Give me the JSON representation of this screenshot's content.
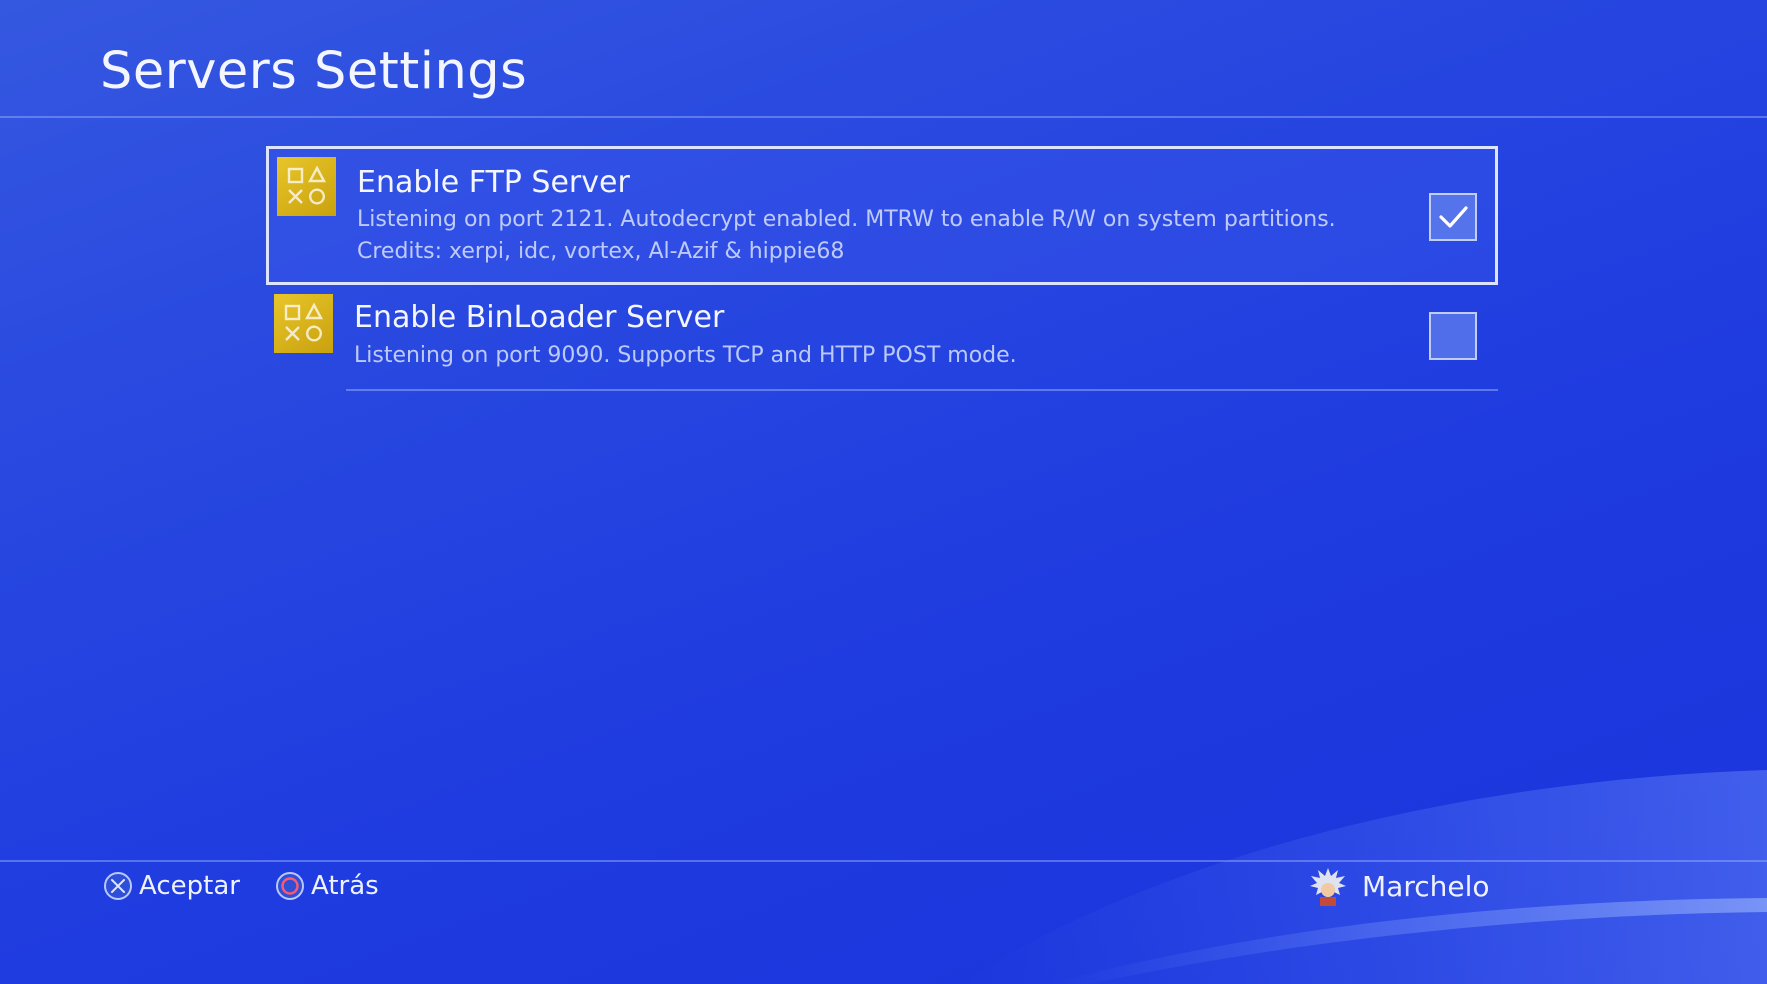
{
  "header": {
    "title": "Servers Settings"
  },
  "items": [
    {
      "title": "Enable FTP Server",
      "desc_line1": "Listening on port 2121. Autodecrypt enabled. MTRW to enable R/W on system partitions.",
      "desc_line2": "Credits: xerpi, idc, vortex, Al-Azif & hippie68",
      "checked": true,
      "icon": "playstation-shapes-icon"
    },
    {
      "title": "Enable BinLoader Server",
      "desc_line1": "Listening on port 9090. Supports TCP and HTTP POST mode.",
      "checked": false,
      "icon": "playstation-shapes-icon"
    }
  ],
  "footer": {
    "accept_label": "Aceptar",
    "accept_icon": "cross-button-icon",
    "back_label": "Atrás",
    "back_icon": "circle-button-icon",
    "user_name": "Marchelo"
  },
  "colors": {
    "background": "#2440e0",
    "icon_gold": "#d9b41a",
    "selection_border": "#e6ecff"
  }
}
